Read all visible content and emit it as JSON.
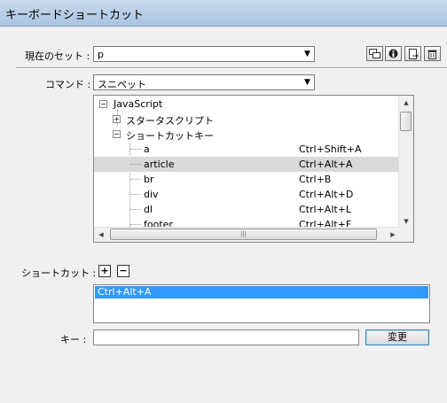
{
  "window": {
    "title": "キーボードショートカット"
  },
  "current_set": {
    "label": "現在のセット :",
    "value": "p"
  },
  "toolbar_icons": [
    "duplicate-set-icon",
    "rename-set-icon",
    "export-set-icon",
    "delete-set-icon"
  ],
  "command": {
    "label": "コマンド :",
    "value": "スニペット"
  },
  "tree": {
    "nodes": [
      {
        "name": "JavaScript",
        "expander": "−",
        "key": ""
      },
      {
        "name": "スタータスクリプト",
        "expander": "+",
        "key": ""
      },
      {
        "name": "ショートカットキー",
        "expander": "−",
        "key": ""
      },
      {
        "name": "a",
        "expander": "",
        "key": "Ctrl+Shift+A"
      },
      {
        "name": "article",
        "expander": "",
        "key": "Ctrl+Alt+A",
        "selected": true
      },
      {
        "name": "br",
        "expander": "",
        "key": "Ctrl+B"
      },
      {
        "name": "div",
        "expander": "",
        "key": "Ctrl+Alt+D"
      },
      {
        "name": "dl",
        "expander": "",
        "key": "Ctrl+Alt+L"
      },
      {
        "name": "footer",
        "expander": "",
        "key": "Ctrl+Alt+F"
      }
    ]
  },
  "shortcut": {
    "label": "ショートカット :",
    "add_symbol": "+",
    "remove_symbol": "−",
    "items": [
      "Ctrl+Alt+A"
    ]
  },
  "key": {
    "label": "キー :",
    "value": ""
  },
  "change_button": {
    "label": "変更"
  },
  "colors": {
    "selection": "#3399ff",
    "tree_selection": "#d9d9d9",
    "titlebar": "#b9cfe7"
  }
}
